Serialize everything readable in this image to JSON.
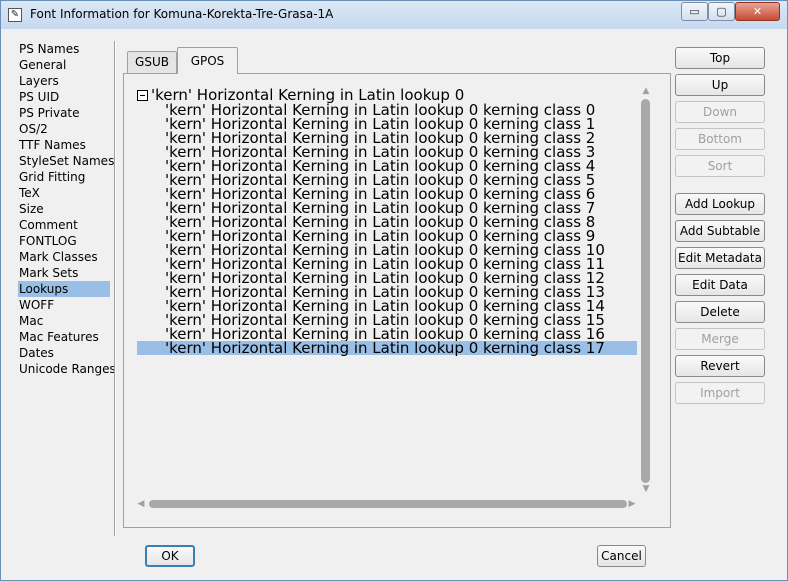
{
  "window": {
    "title": "Font Information for Komuna-Korekta-Tre-Grasa-1A",
    "minimize_glyph": "▭",
    "maximize_glyph": "▢",
    "close_glyph": "✕"
  },
  "sidebar": {
    "items": [
      "PS Names",
      "General",
      "Layers",
      "PS UID",
      "PS Private",
      "OS/2",
      "TTF Names",
      "StyleSet Names",
      "Grid Fitting",
      "TeX",
      "Size",
      "Comment",
      "FONTLOG",
      "Mark Classes",
      "Mark Sets",
      "Lookups",
      "WOFF",
      "Mac",
      "Mac Features",
      "Dates",
      "Unicode Ranges"
    ],
    "selected": "Lookups"
  },
  "tabs": [
    "GSUB",
    "GPOS"
  ],
  "active_tab": "GPOS",
  "lookup_tree": {
    "lookup": "'kern' Horizontal Kerning in Latin lookup 0",
    "subtables": [
      "'kern' Horizontal Kerning in Latin lookup 0 kerning class 0",
      "'kern' Horizontal Kerning in Latin lookup 0 kerning class 1",
      "'kern' Horizontal Kerning in Latin lookup 0 kerning class 2",
      "'kern' Horizontal Kerning in Latin lookup 0 kerning class 3",
      "'kern' Horizontal Kerning in Latin lookup 0 kerning class 4",
      "'kern' Horizontal Kerning in Latin lookup 0 kerning class 5",
      "'kern' Horizontal Kerning in Latin lookup 0 kerning class 6",
      "'kern' Horizontal Kerning in Latin lookup 0 kerning class 7",
      "'kern' Horizontal Kerning in Latin lookup 0 kerning class 8",
      "'kern' Horizontal Kerning in Latin lookup 0 kerning class 9",
      "'kern' Horizontal Kerning in Latin lookup 0 kerning class 10",
      "'kern' Horizontal Kerning in Latin lookup 0 kerning class 11",
      "'kern' Horizontal Kerning in Latin lookup 0 kerning class 12",
      "'kern' Horizontal Kerning in Latin lookup 0 kerning class 13",
      "'kern' Horizontal Kerning in Latin lookup 0 kerning class 14",
      "'kern' Horizontal Kerning in Latin lookup 0 kerning class 15",
      "'kern' Horizontal Kerning in Latin lookup 0 kerning class 16",
      "'kern' Horizontal Kerning in Latin lookup 0 kerning class 17"
    ],
    "selected_index": 17
  },
  "buttons": {
    "top": "Top",
    "up": "Up",
    "down": "Down",
    "bottom": "Bottom",
    "sort": "Sort",
    "add_lookup": "Add Lookup",
    "add_subtable": "Add Subtable",
    "edit_metadata": "Edit Metadata",
    "edit_data": "Edit Data",
    "delete": "Delete",
    "merge": "Merge",
    "revert": "Revert",
    "import": "Import",
    "ok": "OK",
    "cancel": "Cancel"
  },
  "scroll_arrows": {
    "up": "▲",
    "down": "▼",
    "left": "◀",
    "right": "▶"
  }
}
